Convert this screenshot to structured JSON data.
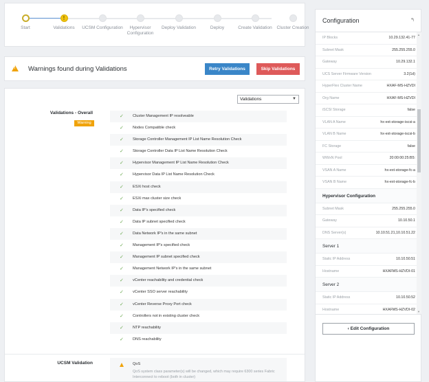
{
  "stepper": {
    "steps": [
      {
        "label": "Start"
      },
      {
        "label": "Validations"
      },
      {
        "label": "UCSM Configuration"
      },
      {
        "label": "Hypervisor Configuration"
      },
      {
        "label": "Deploy Validation"
      },
      {
        "label": "Deploy"
      },
      {
        "label": "Create Validation"
      },
      {
        "label": "Cluster Creation"
      }
    ],
    "warning_glyph": "!"
  },
  "warning_banner": {
    "title": "Warnings found during Validations",
    "retry_label": "Retry Validations",
    "skip_label": "Skip Validations"
  },
  "validations": {
    "filter_value": "Validations",
    "overall_label": "Validations - Overall",
    "overall_status": "Warning",
    "checks": [
      "Cluster Management IP resolveable",
      "Nodes Compatible check",
      "Storage Controller Management IP List Name Resolution Check",
      "Storage Controller Data IP List Name Resolution Check",
      "Hypervisor Management IP List Name Resolution Check",
      "Hypervisor Data IP List Name Resolution Check",
      "ESXi host check",
      "ESXi max cluster size check",
      "Data IP's specified check",
      "Data IP subnet specified check",
      "Data Network IP's in the same subnet",
      "Management IP's specified check",
      "Management IP subnet specified check",
      "Management Network IP's in the same subnet",
      "vCenter reachability and credential check",
      "vCenter SSO server reachability",
      "vCenter Reverse Proxy Port check",
      "Controllers not in existing cluster check",
      "NTP reachability",
      "DNS reachability"
    ],
    "check_glyph": "✓",
    "ucsm_label": "UCSM Validation",
    "qos_title": "QoS",
    "qos_desc": "QoS system class parameter(s) will be changed, which may require 6300 series Fabric Interconnect to reboot (both in cluster)"
  },
  "configuration": {
    "title": "Configuration",
    "pin_icon": "pin-icon",
    "rows": [
      {
        "key": "IP Blocks",
        "value": "10.29.132.41-77"
      },
      {
        "key": "Subnet Mask",
        "value": "255.255.255.0"
      },
      {
        "key": "Gateway",
        "value": "10.29.132.1"
      },
      {
        "key": "UCS Server Firmware Version",
        "value": "3.2(1d)"
      },
      {
        "key": "HyperFlex Cluster Name",
        "value": "HXAF-MS-HZVDI"
      },
      {
        "key": "Org Name",
        "value": "HXAF-MS-HZVDI"
      },
      {
        "key": "iSCSI Storage",
        "value": "false"
      },
      {
        "key": "VLAN A Name",
        "value": "hx-ext-storage-iscsi-a"
      },
      {
        "key": "VLAN B Name",
        "value": "hx-ext-storage-iscsi-b"
      },
      {
        "key": "FC Storage",
        "value": "false"
      },
      {
        "key": "WWxN Pool",
        "value": "20:00:00:25:B5:"
      },
      {
        "key": "VSAN A Name",
        "value": "hx-ext-storage-fc-a"
      },
      {
        "key": "VSAN B Name",
        "value": "hx-ext-storage-fc-b"
      }
    ],
    "hypervisor_title": "Hypervisor Configuration",
    "hypervisor_rows": [
      {
        "key": "Subnet Mask",
        "value": "255.255.255.0"
      },
      {
        "key": "Gateway",
        "value": "10.10.50.1"
      },
      {
        "key": "DNS Server(s)",
        "value": "10.10.51.21,10.10.51.22"
      }
    ],
    "server1_title": "Server 1",
    "server1_rows": [
      {
        "key": "Static IP Address",
        "value": "10.10.50.51"
      },
      {
        "key": "Hostname",
        "value": "HXAFMS-HZVDI-01"
      }
    ],
    "server2_title": "Server 2",
    "server2_rows": [
      {
        "key": "Static IP Address",
        "value": "10.10.50.52"
      },
      {
        "key": "Hostname",
        "value": "HXAFMS-HZVDI-02"
      }
    ],
    "edit_label": "Edit Configuration",
    "edit_glyph": "‹"
  },
  "colors": {
    "accent_blue": "#3a86c8",
    "danger_red": "#de5a5a",
    "warning_orange": "#f0a30a",
    "success_green": "#6aa84f"
  }
}
